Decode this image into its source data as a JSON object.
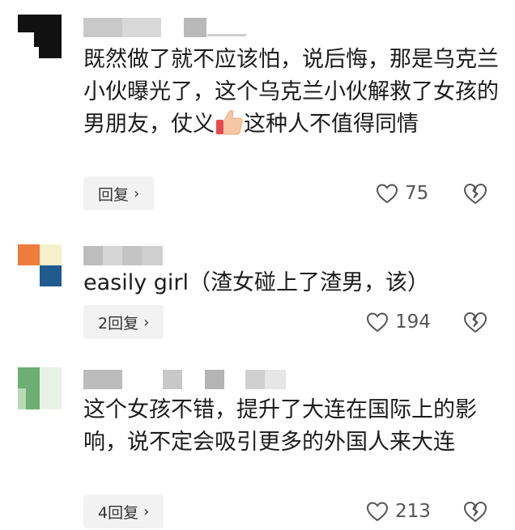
{
  "comments": [
    {
      "text_before_emoji": "既然做了就不应该怕，说后悔，那是乌克兰小伙曝光了，这个乌克兰小伙解救了女孩的男朋友，仗义",
      "emoji": "thumbs-up",
      "text_after_emoji": "这种人不值得同情",
      "reply_label": "回复",
      "like_count": "75"
    },
    {
      "text": "easily girl（渣女碰上了渣男，该）",
      "reply_label": "2回复",
      "like_count": "194"
    },
    {
      "text": "这个女孩不错，提升了大连在国际上的影响，说不定会吸引更多的外国人来大连",
      "reply_label": "4回复",
      "like_count": "213"
    }
  ],
  "icons": {
    "like": "heart-outline-icon",
    "dislike": "broken-heart-icon",
    "reply_chevron": "chevron-right-icon"
  },
  "colors": {
    "avatar1": [
      "#111111",
      "#ffffff"
    ],
    "avatar2": [
      "#ee7d3b",
      "#f6efcc",
      "#1f5b8f"
    ],
    "avatar3": [
      "#6cae74",
      "#b9d9b6",
      "#e8f2e6"
    ]
  }
}
